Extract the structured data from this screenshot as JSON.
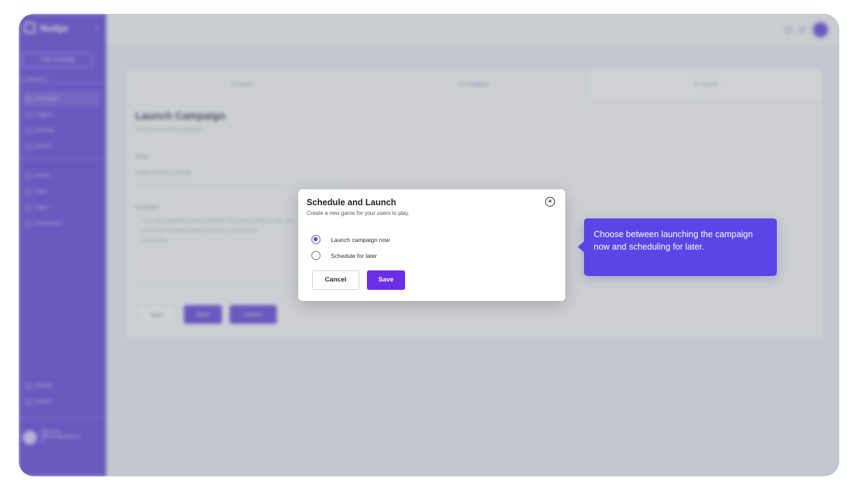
{
  "app": {
    "logo_text": "Nudge",
    "new_button": "+ New Campaign",
    "section_label": "CAMPAIGNS",
    "nav": [
      {
        "label": "Campaigns",
        "icon": "campaign-icon",
        "active": true
      },
      {
        "label": "Triggers",
        "icon": "trigger-icon",
        "active": false
      },
      {
        "label": "Rewards",
        "icon": "reward-icon",
        "active": false
      },
      {
        "label": "Reports",
        "icon": "report-icon",
        "active": false
      }
    ],
    "nav2": [
      {
        "label": "Assets",
        "icon": "asset-icon"
      },
      {
        "label": "Users",
        "icon": "users-icon"
      },
      {
        "label": "Pages",
        "icon": "pages-icon"
      },
      {
        "label": "Connections",
        "icon": "connection-icon"
      }
    ],
    "bottom_nav": [
      {
        "label": "Settings",
        "icon": "gear-icon"
      },
      {
        "label": "Support",
        "icon": "support-icon"
      }
    ],
    "user": {
      "name": "Nikita Sinha",
      "email": "nikita.sinha@company.co",
      "extra": "m"
    }
  },
  "wizard": {
    "steps": [
      "① Name",
      "② Configure",
      "③ Launch"
    ],
    "title": "Launch Campaign",
    "subtitle": "Time to launch your campaign!",
    "name_label": "Name",
    "name_value": "Nudge Journey Campaign",
    "description_label": "Description",
    "description_lines": [
      "This is the engagement journey campaign. This sends rewards to users who",
      "invest in the onboarding stage. Feel free to customize and",
      "around with it."
    ],
    "back_label": "Back",
    "save_label": "Save",
    "launch_label": "Launch"
  },
  "modal": {
    "title": "Schedule and Launch",
    "subtitle": "Create a new game for your users to play.",
    "close_glyph": "×",
    "options": [
      {
        "label": "Launch campaign now",
        "selected": true
      },
      {
        "label": "Schedule for later",
        "selected": false
      }
    ],
    "cancel_label": "Cancel",
    "save_label": "Save"
  },
  "tooltip": {
    "text": "Choose between launching the campaign now and scheduling for later."
  },
  "colors": {
    "brand": "#6a4cde",
    "save_button": "#6a2ee8",
    "tooltip": "#5b45e6"
  }
}
